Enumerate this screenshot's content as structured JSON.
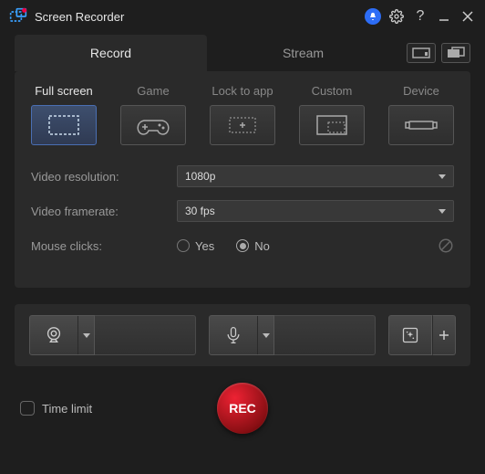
{
  "title": "Screen Recorder",
  "tabs": {
    "record": "Record",
    "stream": "Stream"
  },
  "modes": {
    "full_screen": "Full screen",
    "game": "Game",
    "lock_to_app": "Lock to app",
    "custom": "Custom",
    "device": "Device"
  },
  "form": {
    "resolution_label": "Video resolution:",
    "resolution_value": "1080p",
    "framerate_label": "Video framerate:",
    "framerate_value": "30 fps",
    "mouse_label": "Mouse clicks:",
    "yes": "Yes",
    "no": "No"
  },
  "footer": {
    "time_limit": "Time limit",
    "rec": "REC"
  }
}
